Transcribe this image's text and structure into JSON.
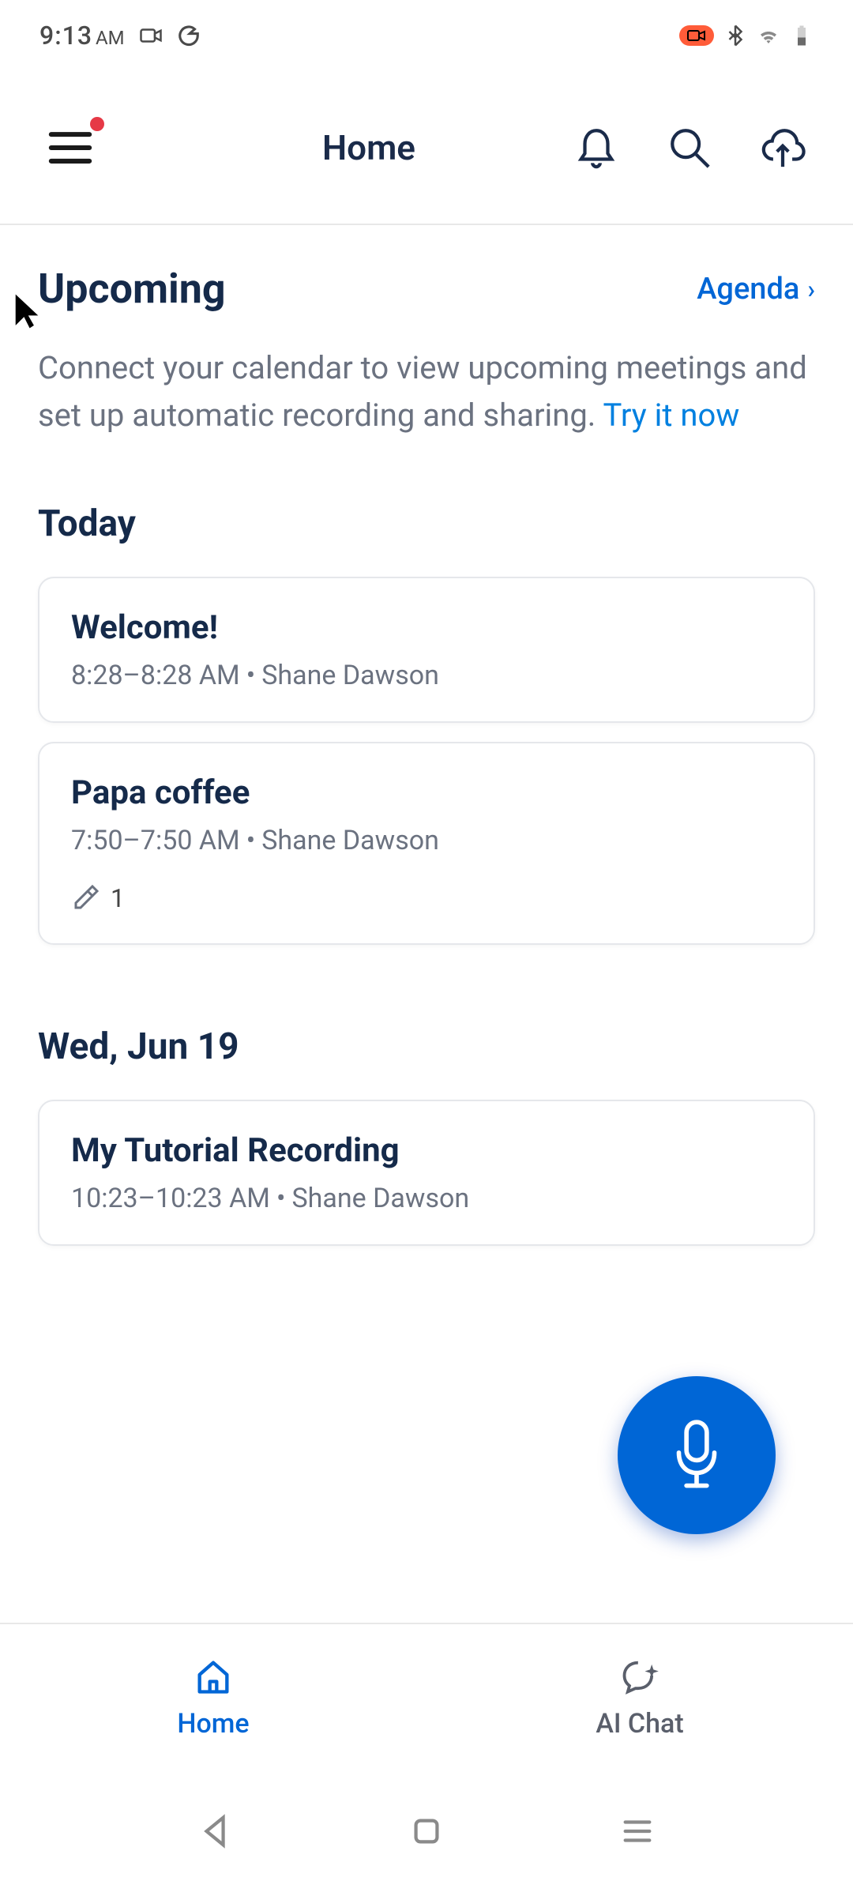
{
  "status_bar": {
    "time": "9:13",
    "am_pm": "AM"
  },
  "header": {
    "title": "Home"
  },
  "upcoming": {
    "heading": "Upcoming",
    "agenda_label": "Agenda",
    "connect_text": "Connect your calendar to view upcoming meetings and set up automatic recording and sharing. ",
    "try_link": "Try it now"
  },
  "sections": [
    {
      "heading": "Today",
      "items": [
        {
          "title": "Welcome!",
          "time": "8:28–8:28 AM",
          "owner": "Shane Dawson",
          "highlight_count": null
        },
        {
          "title": "Papa coffee",
          "time": "7:50–7:50 AM",
          "owner": "Shane Dawson",
          "highlight_count": "1"
        }
      ]
    },
    {
      "heading": "Wed, Jun 19",
      "items": [
        {
          "title": "My Tutorial Recording",
          "time": "10:23–10:23 AM",
          "owner": "Shane Dawson",
          "highlight_count": null
        }
      ]
    }
  ],
  "tabs": {
    "home": "Home",
    "ai_chat": "AI Chat"
  }
}
